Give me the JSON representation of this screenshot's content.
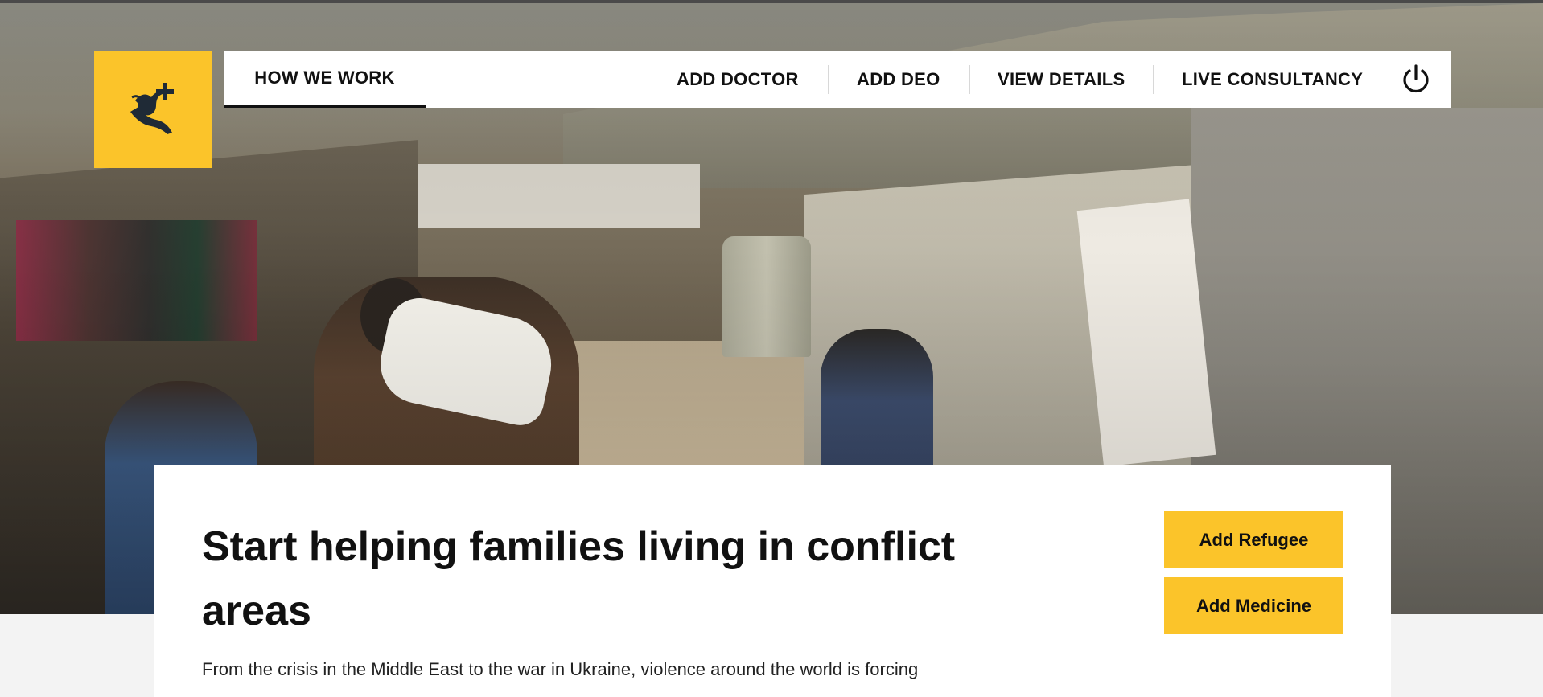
{
  "brand": {
    "logo_icon": "helping-hand-dove-icon",
    "accent_color": "#fbc42a"
  },
  "hero": {
    "image": "refugee-camp-photo"
  },
  "nav": {
    "how_we_work": "HOW WE WORK",
    "add_doctor": "ADD DOCTOR",
    "add_deo": "ADD DEO",
    "view_details": "VIEW DETAILS",
    "live_consultancy": "LIVE CONSULTANCY",
    "power_icon": "power-icon"
  },
  "main": {
    "title": "Start helping families living in conflict areas",
    "body": "From the crisis in the Middle East to the war in Ukraine, violence around the world is forcing",
    "buttons": {
      "add_refugee": "Add Refugee",
      "add_medicine": "Add Medicine"
    }
  }
}
